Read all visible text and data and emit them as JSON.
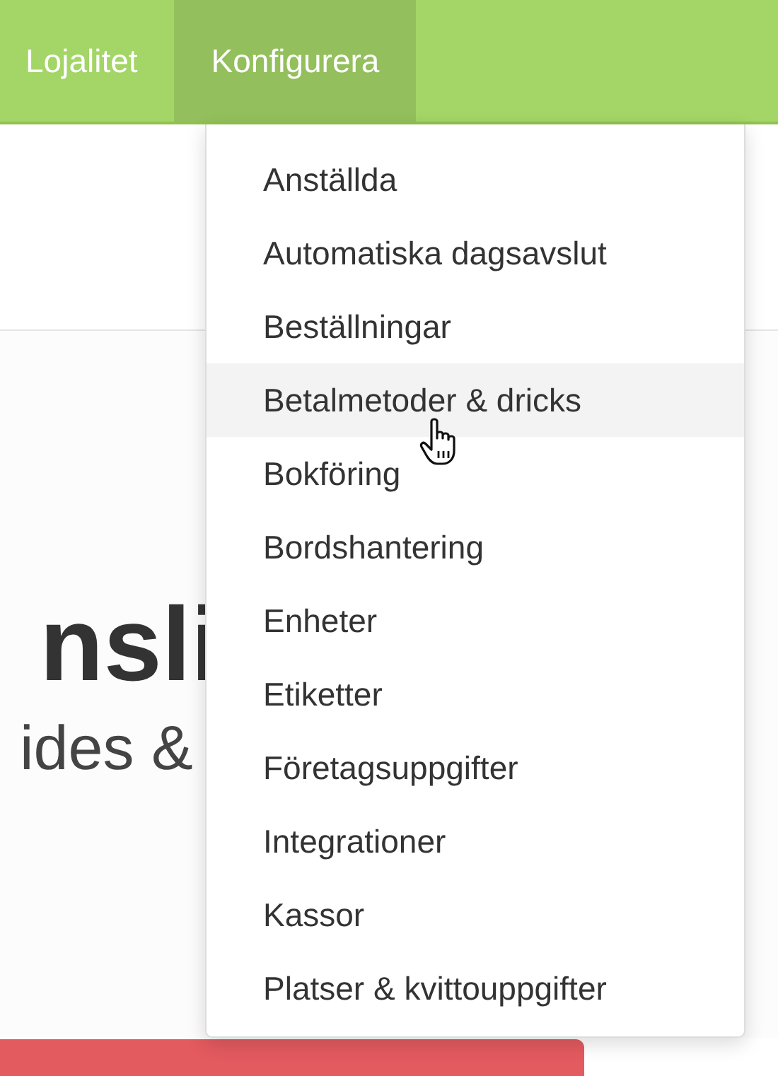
{
  "nav": {
    "tabs": [
      {
        "label": "Lojalitet",
        "selected": false
      },
      {
        "label": "Konfigurera",
        "selected": true
      }
    ]
  },
  "hero": {
    "heading": "nsli",
    "subheading": "ides &"
  },
  "menu": {
    "items": [
      {
        "label": "Anställda",
        "selected": false
      },
      {
        "label": "Automatiska dagsavslut",
        "selected": false
      },
      {
        "label": "Beställningar",
        "selected": false
      },
      {
        "label": "Betalmetoder & dricks",
        "selected": true
      },
      {
        "label": "Bokföring",
        "selected": false
      },
      {
        "label": "Bordshantering",
        "selected": false
      },
      {
        "label": "Enheter",
        "selected": false
      },
      {
        "label": "Etiketter",
        "selected": false
      },
      {
        "label": "Företagsuppgifter",
        "selected": false
      },
      {
        "label": "Integrationer",
        "selected": false
      },
      {
        "label": "Kassor",
        "selected": false
      },
      {
        "label": "Platser & kvittouppgifter",
        "selected": false
      }
    ]
  }
}
